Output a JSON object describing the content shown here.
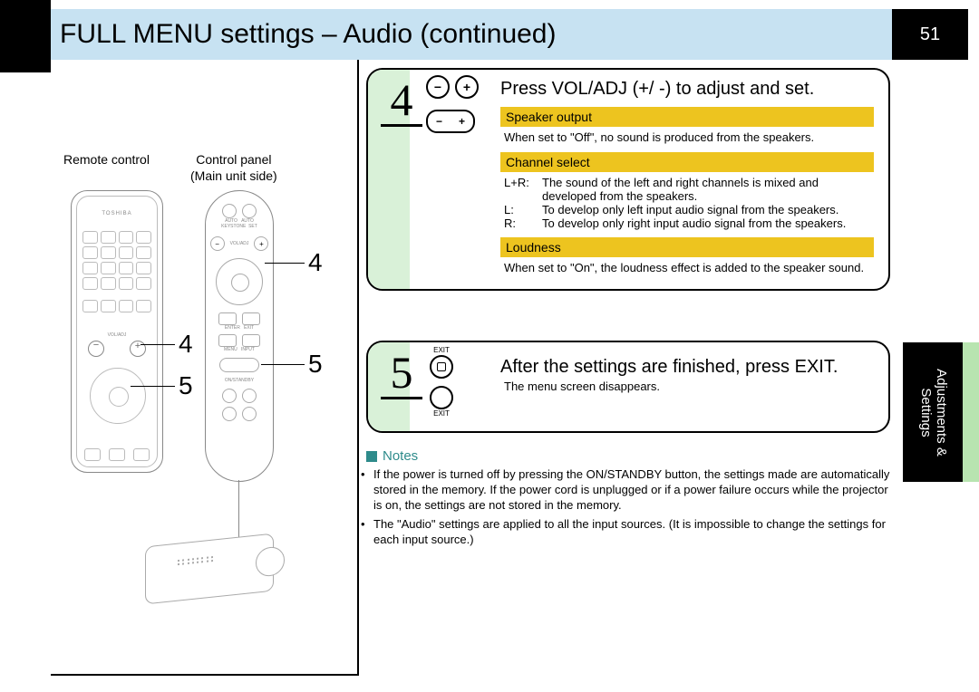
{
  "header": {
    "title": "FULL MENU settings   – Audio (continued)"
  },
  "page_number": "51",
  "left_column": {
    "remote_label": "Remote control",
    "panel_label_line1": "Control panel",
    "panel_label_line2": "(Main unit side)",
    "brand": "TOSHIBA",
    "voladj_label": "VOL/ADJ",
    "callouts": {
      "c4": "4",
      "c5": "5"
    }
  },
  "step4": {
    "number": "4",
    "title": "Press VOL/ADJ (+/ -) to adjust and set.",
    "sections": {
      "speaker_output": {
        "heading": "Speaker output",
        "text": "When set to \"Off\", no sound is produced from the speakers."
      },
      "channel_select": {
        "heading": "Channel select",
        "rows": [
          {
            "key": "L+R:",
            "val": "The sound of the left and right channels is mixed and developed from the speakers."
          },
          {
            "key": "L:",
            "val": "To develop only left input audio signal from the speakers."
          },
          {
            "key": "R:",
            "val": "To develop only right input audio signal from the speakers."
          }
        ]
      },
      "loudness": {
        "heading": "Loudness",
        "text": "When set to \"On\", the loudness effect is added to the speaker sound."
      }
    },
    "icon_labels": {
      "minus": "−",
      "plus": "+"
    }
  },
  "step5": {
    "number": "5",
    "title": "After the settings are finished, press EXIT.",
    "text": "The menu screen disappears.",
    "icon_labels": {
      "exit_top": "EXIT",
      "exit_bottom": "EXIT"
    }
  },
  "notes": {
    "title": "Notes",
    "items": [
      "If the power is turned off by pressing the ON/STANDBY button, the settings made are automatically stored in the memory. If the power cord is unplugged or if a power failure occurs while the projector is on, the settings are not stored in the memory.",
      "The \"Audio\" settings are applied to all the input sources.  (It is impossible to change the settings for each input source.)"
    ]
  },
  "side_tab": {
    "line1": "Adjustments &",
    "line2": "Settings"
  }
}
